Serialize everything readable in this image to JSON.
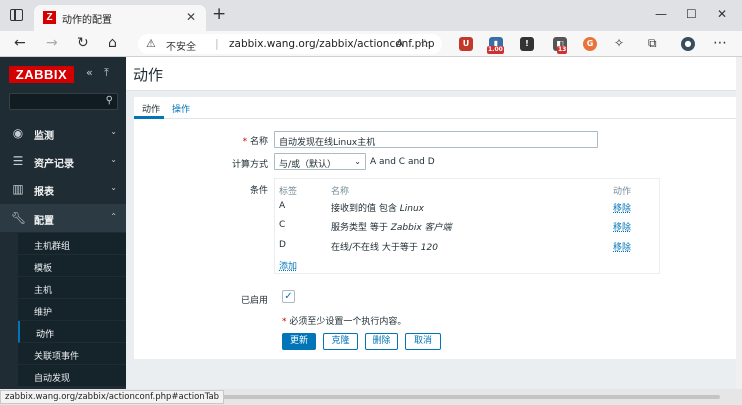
{
  "browser": {
    "tab_title": "动作的配置",
    "favicon_letter": "Z",
    "security_label": "不安全",
    "url": "zabbix.wang.org/zabbix/actionconf.php",
    "status_url": "zabbix.wang.org/zabbix/actionconf.php#actionTab",
    "ext_badge_1": "1.00",
    "ext_badge_2": "13"
  },
  "sidebar": {
    "logo": "ZABBIX",
    "search_placeholder": "",
    "menu": [
      {
        "label": "监测",
        "icon": "eye-icon"
      },
      {
        "label": "资产记录",
        "icon": "list-icon"
      },
      {
        "label": "报表",
        "icon": "bar-chart-icon"
      },
      {
        "label": "配置",
        "icon": "wrench-icon"
      }
    ],
    "submenu": [
      "主机群组",
      "模板",
      "主机",
      "维护",
      "动作",
      "关联项事件",
      "自动发现"
    ]
  },
  "page": {
    "title": "动作",
    "tabs": [
      "动作",
      "操作"
    ],
    "form": {
      "name_label": "名称",
      "name_value": "自动发现在线Linux主机",
      "calc_label": "计算方式",
      "calc_value": "与/或（默认）",
      "calc_expression": "A and C and D",
      "conditions_label": "条件",
      "col_tag": "标签",
      "col_name": "名称",
      "col_action": "动作",
      "conditions": [
        {
          "tag": "A",
          "text": "接收到的值 包含 ",
          "italic": "Linux",
          "action": "移除"
        },
        {
          "tag": "C",
          "text": "服务类型 等于 ",
          "italic": "Zabbix 客户端",
          "action": "移除"
        },
        {
          "tag": "D",
          "text": "在线/不在线 大于等于 ",
          "italic": "120",
          "action": "移除"
        }
      ],
      "add_link": "添加",
      "enabled_label": "已启用",
      "required_note": "必须至少设置一个执行内容。",
      "buttons": {
        "update": "更新",
        "clone": "克隆",
        "delete": "删除",
        "cancel": "取消"
      }
    }
  },
  "colors": {
    "zabbix_red": "#d40000",
    "link_blue": "#0275b8",
    "sidebar_bg": "#1f2c33"
  }
}
